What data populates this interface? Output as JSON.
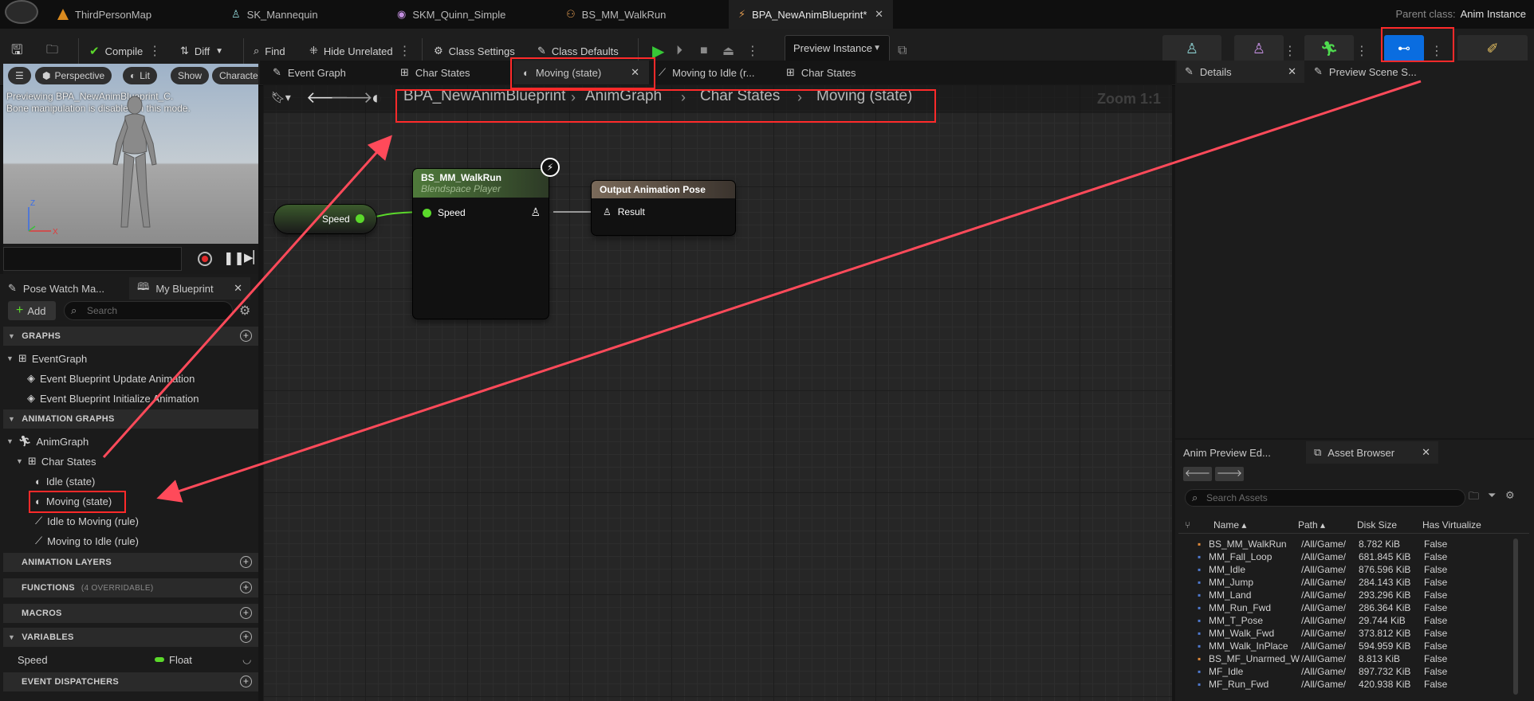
{
  "window": {
    "tabs": [
      {
        "label": "ThirdPersonMap",
        "icon": "map-icon"
      },
      {
        "label": "SK_Mannequin",
        "icon": "skeleton-icon"
      },
      {
        "label": "SKM_Quinn_Simple",
        "icon": "skeletal-mesh-icon"
      },
      {
        "label": "BS_MM_WalkRun",
        "icon": "blendspace-icon"
      },
      {
        "label": "BPA_NewAnimBlueprint*",
        "icon": "anim-blueprint-icon",
        "active": true
      }
    ],
    "parent_class_label": "Parent class:",
    "parent_class_value": "Anim Instance"
  },
  "toolbar": {
    "compile": "Compile",
    "diff": "Diff",
    "find": "Find",
    "hide_unrelated": "Hide Unrelated",
    "class_settings": "Class Settings",
    "class_defaults": "Class Defaults",
    "preview_instance": "Preview Instance"
  },
  "viewport": {
    "perspective": "Perspective",
    "lit": "Lit",
    "show": "Show",
    "character": "Characte",
    "info_line1": "Previewing BPA_NewAnimBlueprint_C.",
    "info_line2": "Bone manipulation is disabled in this mode."
  },
  "my_blueprint": {
    "tab_pose_watch": "Pose Watch Ma...",
    "tab_my_blueprint": "My Blueprint",
    "add_label": "Add",
    "search_placeholder": "Search",
    "graphs_header": "GRAPHS",
    "event_graph": "EventGraph",
    "event_update": "Event Blueprint Update Animation",
    "event_initialize": "Event Blueprint Initialize Animation",
    "anim_graphs_header": "ANIMATION GRAPHS",
    "anim_graph": "AnimGraph",
    "char_states": "Char States",
    "idle_state": "Idle (state)",
    "moving_state": "Moving (state)",
    "idle_to_moving": "Idle to Moving (rule)",
    "moving_to_idle": "Moving to Idle (rule)",
    "anim_layers_header": "ANIMATION LAYERS",
    "functions_header": "FUNCTIONS",
    "functions_count": "(4 OVERRIDABLE)",
    "macros_header": "MACROS",
    "variables_header": "VARIABLES",
    "var_name": "Speed",
    "var_type": "Float",
    "event_dispatchers_header": "EVENT DISPATCHERS"
  },
  "graph_tabs": [
    {
      "label": "Event Graph"
    },
    {
      "label": "Char States"
    },
    {
      "label": "Moving (state)",
      "active": true
    },
    {
      "label": "Moving to Idle (r..."
    },
    {
      "label": "Char States"
    }
  ],
  "breadcrumb": {
    "root": "BPA_NewAnimBlueprint",
    "anim_graph": "AnimGraph",
    "char_states": "Char States",
    "current": "Moving (state)",
    "zoom": "Zoom 1:1"
  },
  "nodes": {
    "speed_var": "Speed",
    "blendspace_title": "BS_MM_WalkRun",
    "blendspace_subtitle": "Blendspace Player",
    "blendspace_pin": "Speed",
    "output_title": "Output Animation Pose",
    "output_pin": "Result"
  },
  "details": {
    "tab_details": "Details",
    "tab_preview_scene": "Preview Scene S..."
  },
  "asset_browser": {
    "tab_anim_preview": "Anim Preview Ed...",
    "tab_asset_browser": "Asset Browser",
    "search_placeholder": "Search Assets",
    "columns": [
      "Name",
      "Path",
      "Disk Size",
      "Has Virtualize"
    ],
    "rows": [
      {
        "name": "BS_MM_WalkRun",
        "path": "/All/Game/",
        "size": "8.782 KiB",
        "virt": "False"
      },
      {
        "name": "MM_Fall_Loop",
        "path": "/All/Game/",
        "size": "681.845 KiB",
        "virt": "False"
      },
      {
        "name": "MM_Idle",
        "path": "/All/Game/",
        "size": "876.596 KiB",
        "virt": "False"
      },
      {
        "name": "MM_Jump",
        "path": "/All/Game/",
        "size": "284.143 KiB",
        "virt": "False"
      },
      {
        "name": "MM_Land",
        "path": "/All/Game/",
        "size": "293.296 KiB",
        "virt": "False"
      },
      {
        "name": "MM_Run_Fwd",
        "path": "/All/Game/",
        "size": "286.364 KiB",
        "virt": "False"
      },
      {
        "name": "MM_T_Pose",
        "path": "/All/Game/",
        "size": "29.744 KiB",
        "virt": "False"
      },
      {
        "name": "MM_Walk_Fwd",
        "path": "/All/Game/",
        "size": "373.812 KiB",
        "virt": "False"
      },
      {
        "name": "MM_Walk_InPlace",
        "path": "/All/Game/",
        "size": "594.959 KiB",
        "virt": "False"
      },
      {
        "name": "BS_MF_Unarmed_W",
        "path": "/All/Game/",
        "size": "8.813 KiB",
        "virt": "False"
      },
      {
        "name": "MF_Idle",
        "path": "/All/Game/",
        "size": "897.732 KiB",
        "virt": "False"
      },
      {
        "name": "MF_Run_Fwd",
        "path": "/All/Game/",
        "size": "420.938 KiB",
        "virt": "False"
      }
    ]
  },
  "colors": {
    "accent_blue": "#0a6de0",
    "annotation_red": "#ff2a2a",
    "exec_green": "#5bd92b"
  }
}
